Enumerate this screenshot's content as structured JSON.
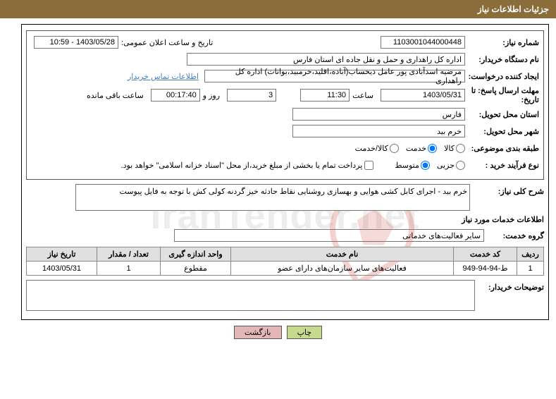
{
  "header": {
    "title": "جزئیات اطلاعات نیاز"
  },
  "need": {
    "number_label": "شماره نیاز:",
    "number": "1103001044000448",
    "announce_label": "تاریخ و ساعت اعلان عمومی:",
    "announce_value": "1403/05/28 - 10:59"
  },
  "buyer": {
    "label": "نام دستگاه خریدار:",
    "value": "اداره کل راهداری و حمل و نقل جاده ای استان فارس"
  },
  "requester": {
    "label": "ایجاد کننده درخواست:",
    "value": "مرضیه اسدآبادی پور عامل ذیحساب(آباده،اقلید،خرمبید،بوانات) اداره کل راهداری",
    "contact_link": "اطلاعات تماس خریدار"
  },
  "deadline": {
    "label1": "مهلت ارسال پاسخ: تا",
    "label2": "تاریخ:",
    "date": "1403/05/31",
    "time_label": "ساعت",
    "time": "11:30",
    "days": "3",
    "days_label": "روز و",
    "hms": "00:17:40",
    "remaining_label": "ساعت باقی مانده"
  },
  "province": {
    "label": "استان محل تحویل:",
    "value": "فارس"
  },
  "city": {
    "label": "شهر محل تحویل:",
    "value": "خرم بید"
  },
  "category": {
    "label": "طبقه بندی موضوعی:",
    "opt_goods": "کالا",
    "opt_service": "خدمت",
    "opt_goods_service": "کالا/خدمت"
  },
  "process": {
    "label": "نوع فرآیند خرید :",
    "opt_partial": "جزیی",
    "opt_medium": "متوسط",
    "note": "پرداخت تمام یا بخشی از مبلغ خرید،از محل \"اسناد خزانه اسلامی\" خواهد بود."
  },
  "description": {
    "label": "شرح کلی نیاز:",
    "text": "خرم بید - اجرای کابل کشی هوایی و بهسازی روشنایی نقاط حادثه خیز گردنه کولی کش با توجه به فایل پیوست"
  },
  "services_section": {
    "title": "اطلاعات خدمات مورد نیاز"
  },
  "group": {
    "label": "گروه خدمت:",
    "value": "سایر فعالیت‌های خدماتی"
  },
  "table": {
    "headers": {
      "radif": "ردیف",
      "code": "کد خدمت",
      "name": "نام خدمت",
      "unit": "واحد اندازه گیری",
      "qty": "تعداد / مقدار",
      "date": "تاریخ نیاز"
    },
    "row": {
      "radif": "1",
      "code": "ط-94-94-949",
      "name": "فعالیت‌های سایر سازمان‌های دارای عضو",
      "unit": "مقطوع",
      "qty": "1",
      "date": "1403/05/31"
    }
  },
  "buyer_notes": {
    "label": "توضیحات خریدار:",
    "text": ""
  },
  "buttons": {
    "print": "چاپ",
    "back": "بازگشت"
  },
  "watermark": "IranTender.net"
}
